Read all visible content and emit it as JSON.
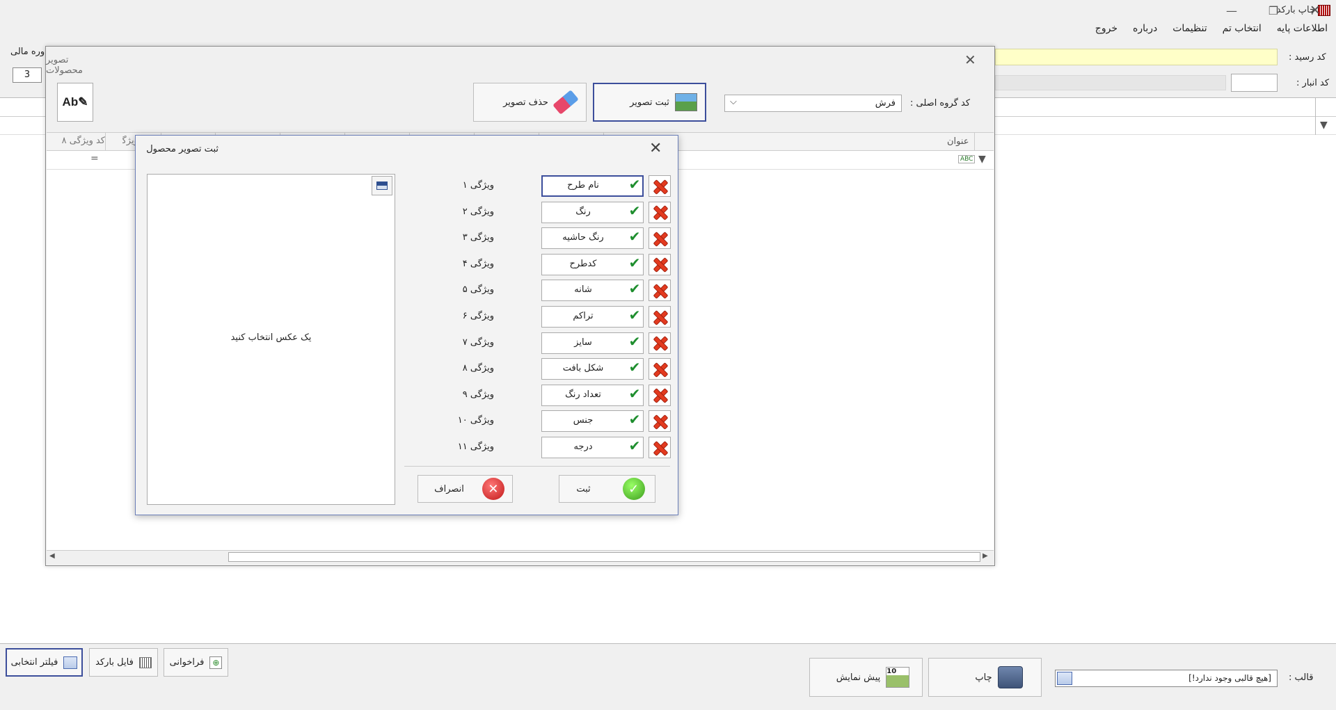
{
  "app": {
    "title": "چاپ بارکد"
  },
  "menu": [
    "اطلاعات پایه",
    "انتخاب تم",
    "تنظیمات",
    "درباره",
    "خروج"
  ],
  "main_form": {
    "receipt_label": "کد رسید :",
    "warehouse_label": "کد انبار :",
    "period_label": "دوره مالی",
    "period_value": "3"
  },
  "bottom_bar": {
    "filter_label": "فیلتر انتخابی",
    "barcode_file_label": "فایل بارکد",
    "recall_label": "فراخوانی",
    "preview_label": "پیش نمایش",
    "print_label": "چاپ",
    "template_label": "قالب :",
    "template_value": "[هیچ قالبی وجود ندارد!]"
  },
  "products_window": {
    "title": "تصویر محصولات",
    "save_image_label": "ثبت تصویر",
    "delete_image_label": "حذف تصویر",
    "group_label": "کد گروه اصلی :",
    "group_value": "فرش",
    "grid": {
      "col_title": "عنوان",
      "col_feature8": "کد ویژگی ۸",
      "col_feature7": "کد ویژگی"
    }
  },
  "dialog": {
    "title": "ثبت تصویر محصول",
    "placeholder": "یک عکس انتخاب کنید",
    "features": [
      {
        "label": "ویژگی ۱",
        "value": "نام طرح"
      },
      {
        "label": "ویژگی ۲",
        "value": "رنگ"
      },
      {
        "label": "ویژگی ۳",
        "value": "رنگ حاشیه"
      },
      {
        "label": "ویژگی ۴",
        "value": "کدطرح"
      },
      {
        "label": "ویژگی ۵",
        "value": "شانه"
      },
      {
        "label": "ویژگی ۶",
        "value": "تراکم"
      },
      {
        "label": "ویژگی ۷",
        "value": "سایز"
      },
      {
        "label": "ویژگی ۸",
        "value": "شکل بافت"
      },
      {
        "label": "ویژگی ۹",
        "value": "تعداد رنگ"
      },
      {
        "label": "ویژگی ۱۰",
        "value": "جنس"
      },
      {
        "label": "ویژگی ۱۱",
        "value": "درجه"
      }
    ],
    "ok_label": "ثبت",
    "cancel_label": "انصراف"
  },
  "colors": {
    "accent_border": "#3c4e9b",
    "receipt_field": "#ffffc8",
    "check": "#1e8e2e",
    "delete": "#e33a1f"
  }
}
